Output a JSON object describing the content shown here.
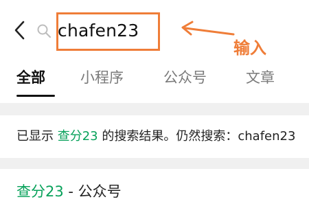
{
  "header": {
    "search_value": "chafen23"
  },
  "annotation": {
    "label": "输入",
    "color": "#ef7d38"
  },
  "tabs": [
    {
      "label": "全部",
      "active": true
    },
    {
      "label": "小程序",
      "active": false
    },
    {
      "label": "公众号",
      "active": false
    },
    {
      "label": "文章",
      "active": false
    }
  ],
  "notice": {
    "prefix": "已显示 ",
    "keyword": "查分23",
    "middle": " 的搜索结果。仍然搜索：",
    "original_query": "chafen23"
  },
  "result": {
    "name": "查分23",
    "suffix": " - 公众号"
  },
  "colors": {
    "accent_green": "#07a15a",
    "annotation_orange": "#ef7d38",
    "band_gray": "#f0f0f0"
  },
  "icons": {
    "back": "chevron-left-icon",
    "search": "search-icon"
  }
}
